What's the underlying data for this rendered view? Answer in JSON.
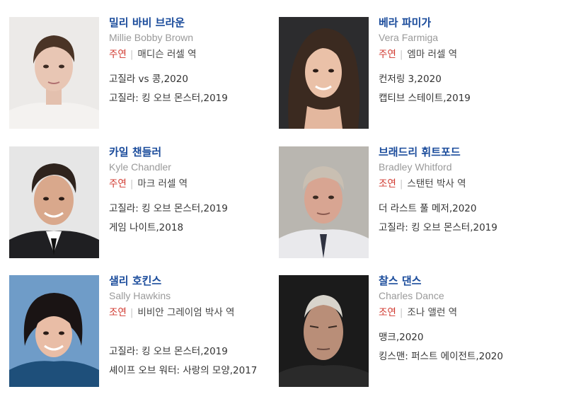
{
  "cast": [
    {
      "name": "밀리 바비 브라운",
      "english_name": "Millie Bobby Brown",
      "role_type": "주연",
      "role": "매디슨 러셀 역",
      "films": [
        "고질라 vs 콩,2020",
        "고질라: 킹 오브 몬스터,2019"
      ]
    },
    {
      "name": "베라 파미가",
      "english_name": "Vera Farmiga",
      "role_type": "주연",
      "role": "엠마 러셀 역",
      "films": [
        "컨저링 3,2020",
        "캡티브 스테이트,2019"
      ]
    },
    {
      "name": "카일 챈들러",
      "english_name": "Kyle Chandler",
      "role_type": "주연",
      "role": "마크 러셀 역",
      "films": [
        "고질라: 킹 오브 몬스터,2019",
        "게임 나이트,2018"
      ]
    },
    {
      "name": "브래드리 휘트포드",
      "english_name": "Bradley Whitford",
      "role_type": "조연",
      "role": "스탠턴 박사 역",
      "films": [
        "더 라스트 풀 메저,2020",
        "고질라: 킹 오브 몬스터,2019"
      ]
    },
    {
      "name": "샐리 호킨스",
      "english_name": "Sally Hawkins",
      "role_type": "조연",
      "role": "비비안 그레이엄 박사 역",
      "films": [
        "고질라: 킹 오브 몬스터,2019",
        "셰이프 오브 워터: 사랑의 모양,2017"
      ]
    },
    {
      "name": "찰스 댄스",
      "english_name": "Charles Dance",
      "role_type": "조연",
      "role": "조나 앨런 역",
      "films": [
        "맹크,2020",
        "킹스맨: 퍼스트 에이전트,2020"
      ]
    }
  ],
  "colors": {
    "name_link": "#1a4b9b",
    "role_type": "#d0372d",
    "english_name": "#9a9a9a"
  }
}
